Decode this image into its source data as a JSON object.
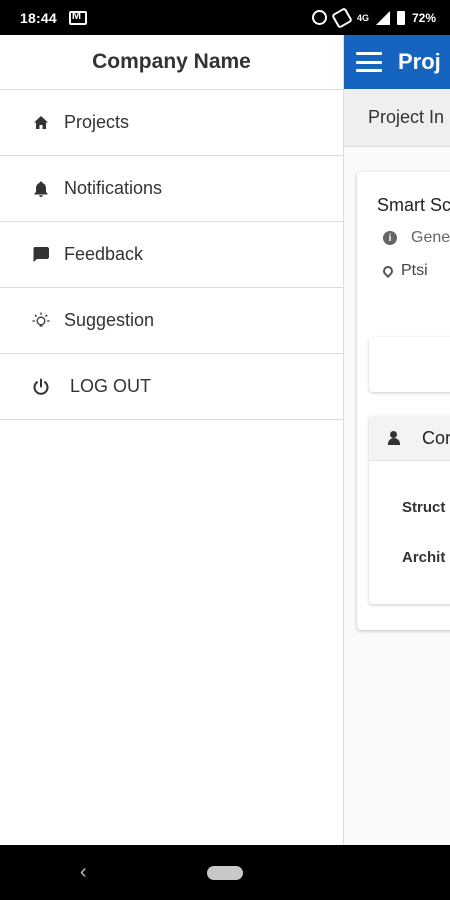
{
  "status_bar": {
    "time": "18:44",
    "network": "4G",
    "battery": "72%"
  },
  "background_app": {
    "header_title": "Proj",
    "tab_label": "Project In",
    "project_name": "Smart Sc",
    "category": "Gene",
    "location": "Ptsi",
    "contacts_title": "Cor",
    "contact_roles": [
      "Struct",
      "Archit"
    ]
  },
  "drawer": {
    "company_name": "Company Name",
    "items": [
      {
        "label": "Projects",
        "icon": "home-icon"
      },
      {
        "label": "Notifications",
        "icon": "bell-icon"
      },
      {
        "label": "Feedback",
        "icon": "chat-icon"
      },
      {
        "label": "Suggestion",
        "icon": "lightbulb-icon"
      },
      {
        "label": "LOG OUT",
        "icon": "power-icon"
      }
    ]
  },
  "nav_bar": {
    "back_glyph": "‹"
  },
  "colors": {
    "header_blue": "#1565c0",
    "divider": "#dedede"
  }
}
